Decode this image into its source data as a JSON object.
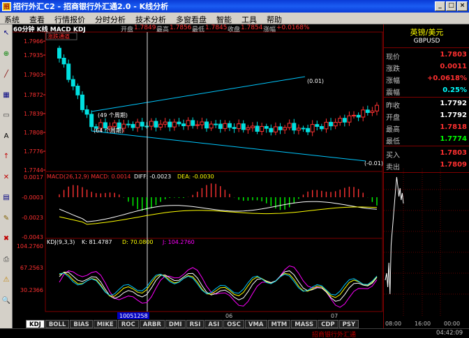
{
  "titlebar": {
    "title": "招行外汇C2 - 招商银行外汇通2.0 - K线分析",
    "icon_text": "招",
    "min": "_",
    "max": "□",
    "close": "×"
  },
  "menu": [
    "系统",
    "查看",
    "行情报价",
    "分时分析",
    "技术分析",
    "多窗看盘",
    "智能",
    "工具",
    "帮助"
  ],
  "infobar": {
    "period_label": "60分钟 K线 MACD KDJ",
    "open_label": "开盘",
    "open_value": "1.7849",
    "high_label": "最高",
    "high_value": "1.7856",
    "low_label": "最低",
    "low_value": "1.7845",
    "close_label": "收盘",
    "close_value": "1.7854",
    "change_label": "涨幅",
    "change_value": "+0.0168%"
  },
  "main_chart": {
    "overlay_title": "涨跌通道",
    "y_labels": [
      "1.7966",
      "1.7935",
      "1.7903",
      "1.7872",
      "1.7839",
      "1.7808",
      "1.7776",
      "1.7744"
    ],
    "annotations": {
      "upper_slope": "(0.01)",
      "lower_slope": "(-0.01)",
      "upper_period": "(49 个周期)",
      "lower_period": "(64 个周期)"
    }
  },
  "macd_panel": {
    "title": "MACD(26,12,9) MACD: 0.0014",
    "diff": "DIFF: -0.0023",
    "dea": "DEA: -0.0030",
    "y_labels": [
      "0.0017",
      "-0.0003",
      "-0.0023",
      "-0.0043"
    ]
  },
  "kdj_panel": {
    "title": "KDJ(9,3,3)",
    "k": "K: 81.4787",
    "d": "D: 70.0800",
    "j": "J: 104.2760",
    "y_labels": [
      "104.2760",
      "67.2563",
      "30.2366"
    ]
  },
  "x_axis": {
    "cursor_label": "10051258",
    "labels": [
      "06",
      "07"
    ]
  },
  "tabs": [
    "KDJ",
    "BOLL",
    "BIAS",
    "MIKE",
    "ROC",
    "ARBR",
    "DMI",
    "RSI",
    "ASI",
    "OSC",
    "VMA",
    "MTM",
    "MASS",
    "CDP",
    "PSY"
  ],
  "status_text": "招商银行外汇通",
  "right_panel": {
    "name": "英镑/美元",
    "code": "GBPUSD",
    "rows": [
      {
        "label": "现价",
        "value": "1.7803",
        "color": "#ff3030"
      },
      {
        "label": "涨跌",
        "value": "0.0011",
        "color": "#ff3030"
      },
      {
        "label": "涨幅",
        "value": "+0.0618%",
        "color": "#ff3030"
      },
      {
        "label": "震幅",
        "value": "0.25%",
        "color": "#00ffff"
      },
      {
        "label": "昨收",
        "value": "1.7792",
        "color": "#ffffff"
      },
      {
        "label": "开盘",
        "value": "1.7792",
        "color": "#ffffff"
      },
      {
        "label": "最高",
        "value": "1.7818",
        "color": "#ff3030"
      },
      {
        "label": "最低",
        "value": "1.7774",
        "color": "#00ff00"
      },
      {
        "label": "买入",
        "value": "1.7803",
        "color": "#ff3030"
      },
      {
        "label": "卖出",
        "value": "1.7809",
        "color": "#ff3030"
      }
    ],
    "mini_times": [
      "08:00",
      "16:00",
      "00:00"
    ],
    "clock": "04:42:09"
  },
  "colors": {
    "up": "#ff3232",
    "down": "#00e0e0",
    "grid": "#800000",
    "k_line": "#ffffff",
    "d_line": "#ffff00",
    "j_line": "#ff00ff",
    "channel": "#00c8ff"
  },
  "left_toolbar_icons": [
    "cursor-icon",
    "zoom-icon",
    "line-icon",
    "grid-icon",
    "ruler-icon",
    "text-icon",
    "arrow-icon",
    "cross-icon",
    "chart-icon",
    "pen-icon",
    "delete-icon",
    "print-icon",
    "warning-icon",
    "search-icon"
  ]
}
